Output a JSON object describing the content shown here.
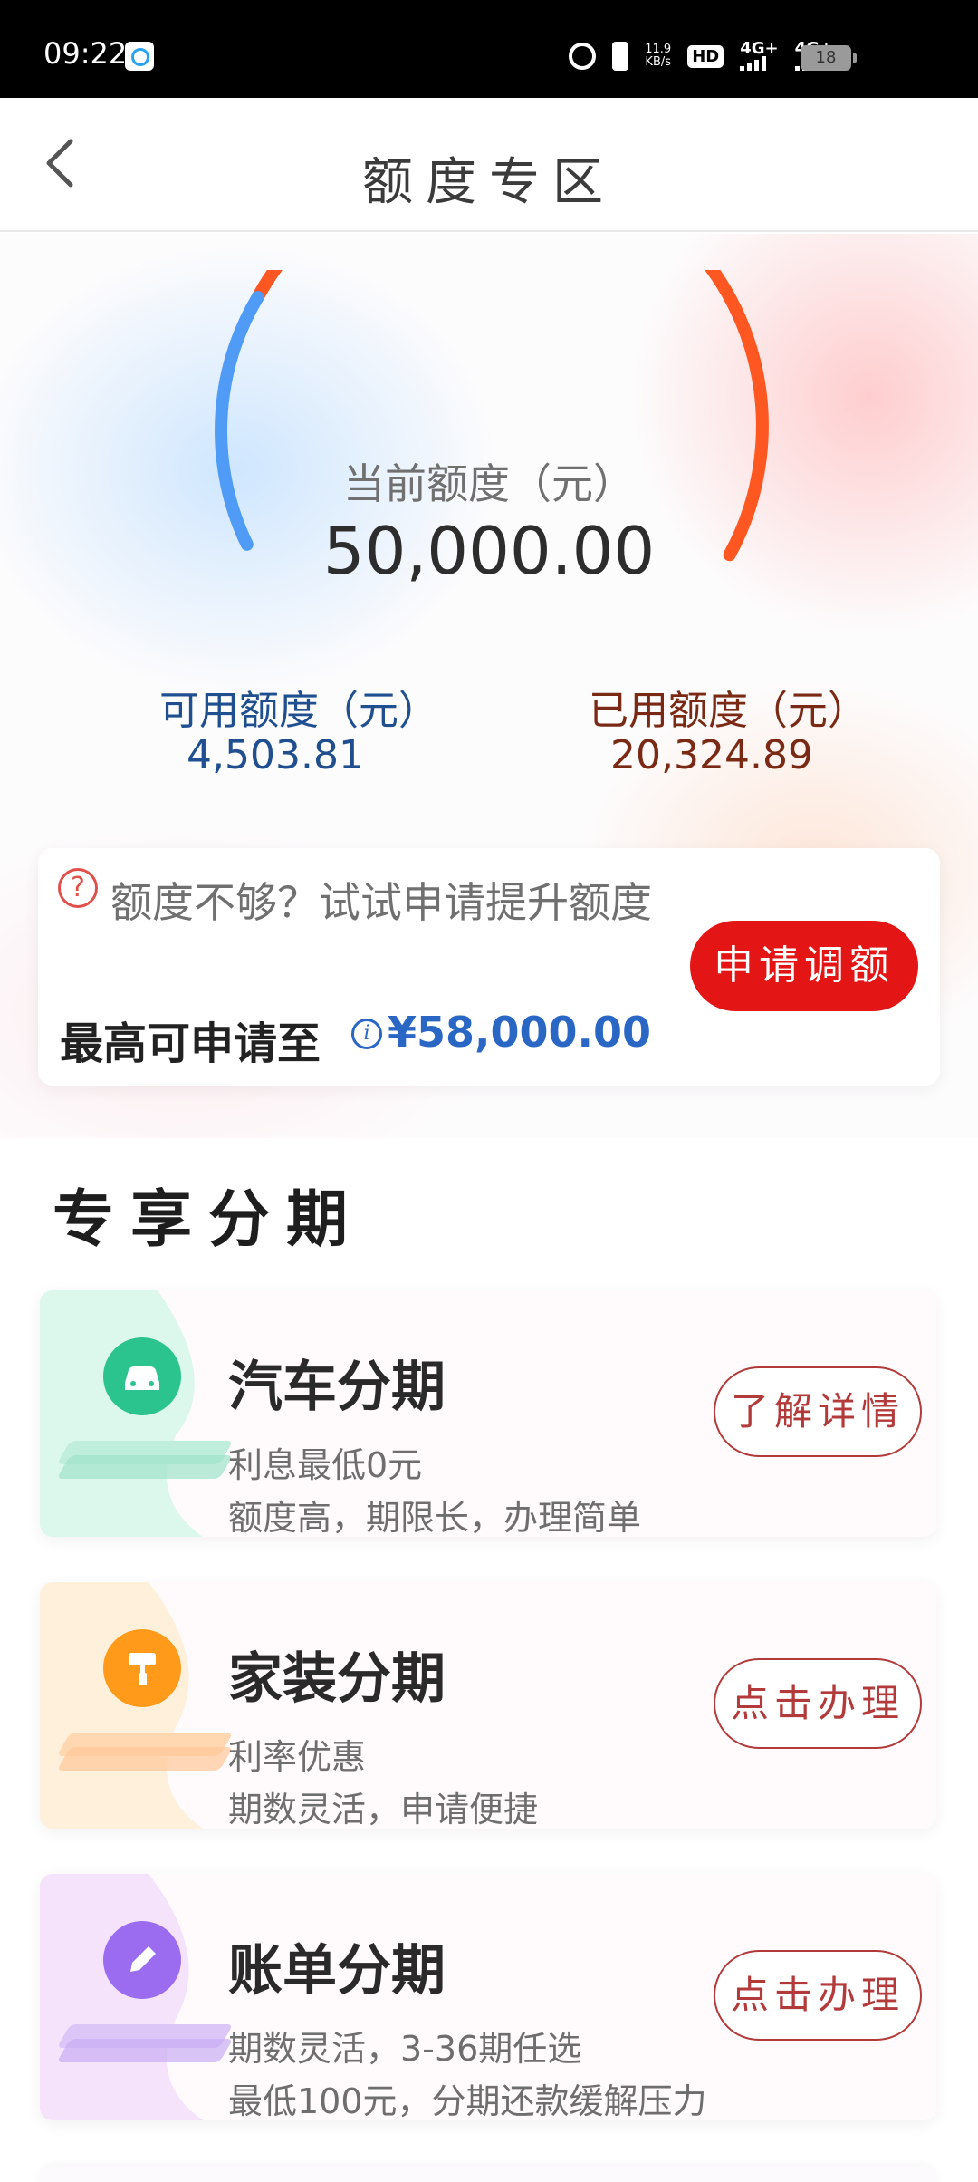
{
  "status_bar": {
    "time": "09:22",
    "net_speed_top": "11.9",
    "net_speed_unit": "KB/s",
    "hd_label": "HD",
    "signal1": "4G+",
    "signal2": "4G+",
    "battery": "18"
  },
  "nav": {
    "title": "额度专区"
  },
  "credit": {
    "current_label": "当前额度（元）",
    "current_value": "50,000.00",
    "available_label": "可用额度（元）",
    "available_value": "4,503.81",
    "used_label": "已用额度（元）",
    "used_value": "20,324.89",
    "gauge_colors": {
      "available": "#4f9bf5",
      "used": "#ff5722"
    }
  },
  "raise": {
    "tip": "额度不够？试试申请提升额度",
    "max_label": "最高可申请至",
    "max_value": "¥58,000.00",
    "button": "申请调额"
  },
  "section": {
    "title": "专享分期"
  },
  "products": [
    {
      "title": "汽车分期",
      "desc1": "利息最低0元",
      "desc2": "额度高，期限长，办理简单",
      "button": "了解详情",
      "icon": "car-icon",
      "color": "#2bc48f"
    },
    {
      "title": "家装分期",
      "desc1": "利率优惠",
      "desc2": "期数灵活，申请便捷",
      "button": "点击办理",
      "icon": "paint-roller-icon",
      "color": "#ff9a1a"
    },
    {
      "title": "账单分期",
      "desc1": "期数灵活，3-36期任选",
      "desc2": "最低100元，分期还款缓解压力",
      "button": "点击办理",
      "icon": "pen-icon",
      "color": "#9b6cf0"
    }
  ]
}
